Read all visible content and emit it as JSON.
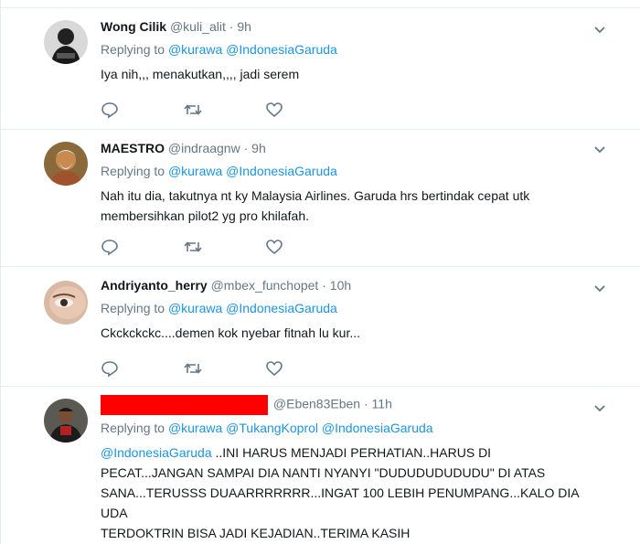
{
  "tweets": [
    {
      "name": "Wong Cilik",
      "handle": "@kuli_alit",
      "time": "9h",
      "replying_label": "Replying to",
      "mentions": [
        "@kurawa",
        "@IndonesiaGaruda"
      ],
      "text": "Iya nih,,, menakutkan,,,, jadi serem"
    },
    {
      "name": "MAESTRO",
      "handle": "@indraagnw",
      "time": "9h",
      "replying_label": "Replying to",
      "mentions": [
        "@kurawa",
        "@IndonesiaGaruda"
      ],
      "text_lines": [
        "Nah itu dia, takutnya nt ky Malaysia Airlines. Garuda hrs bertindak cepat utk",
        "membersihkan pilot2 yg pro khilafah."
      ]
    },
    {
      "name": "Andriyanto_herry",
      "handle": "@mbex_funchopet",
      "time": "10h",
      "replying_label": "Replying to",
      "mentions": [
        "@kurawa",
        "@IndonesiaGaruda"
      ],
      "text": "Ckckckckc....demen kok nyebar fitnah lu kur..."
    },
    {
      "name": "",
      "handle": "@Eben83Eben",
      "time": "11h",
      "replying_label": "Replying to",
      "mentions": [
        "@kurawa",
        "@TukangKoprol",
        "@IndonesiaGaruda"
      ],
      "text_mention": "@IndonesiaGaruda",
      "text_lines": [
        " ..INI HARUS MENJADI PERHATIAN..HARUS DI",
        "PECAT...JANGAN SAMPAI DIA NANTI NYANYI \"DUDUDUDUDUDU\" DI ATAS",
        "SANA...TERUSSS DUAARRRRRRR...INGAT 100 LEBIH PENUMPANG...KALO DIA UDA",
        "TERDOKTRIN BISA JADI KEJADIAN..TERIMA KASIH"
      ]
    }
  ],
  "colors": {
    "link": "#1b95e0",
    "muted": "#657786",
    "text": "#14171a",
    "divider": "#e6ecf0",
    "redaction": "#ff0000"
  },
  "icons": [
    "reply-icon",
    "retweet-icon",
    "like-icon",
    "chevron-down-icon"
  ]
}
